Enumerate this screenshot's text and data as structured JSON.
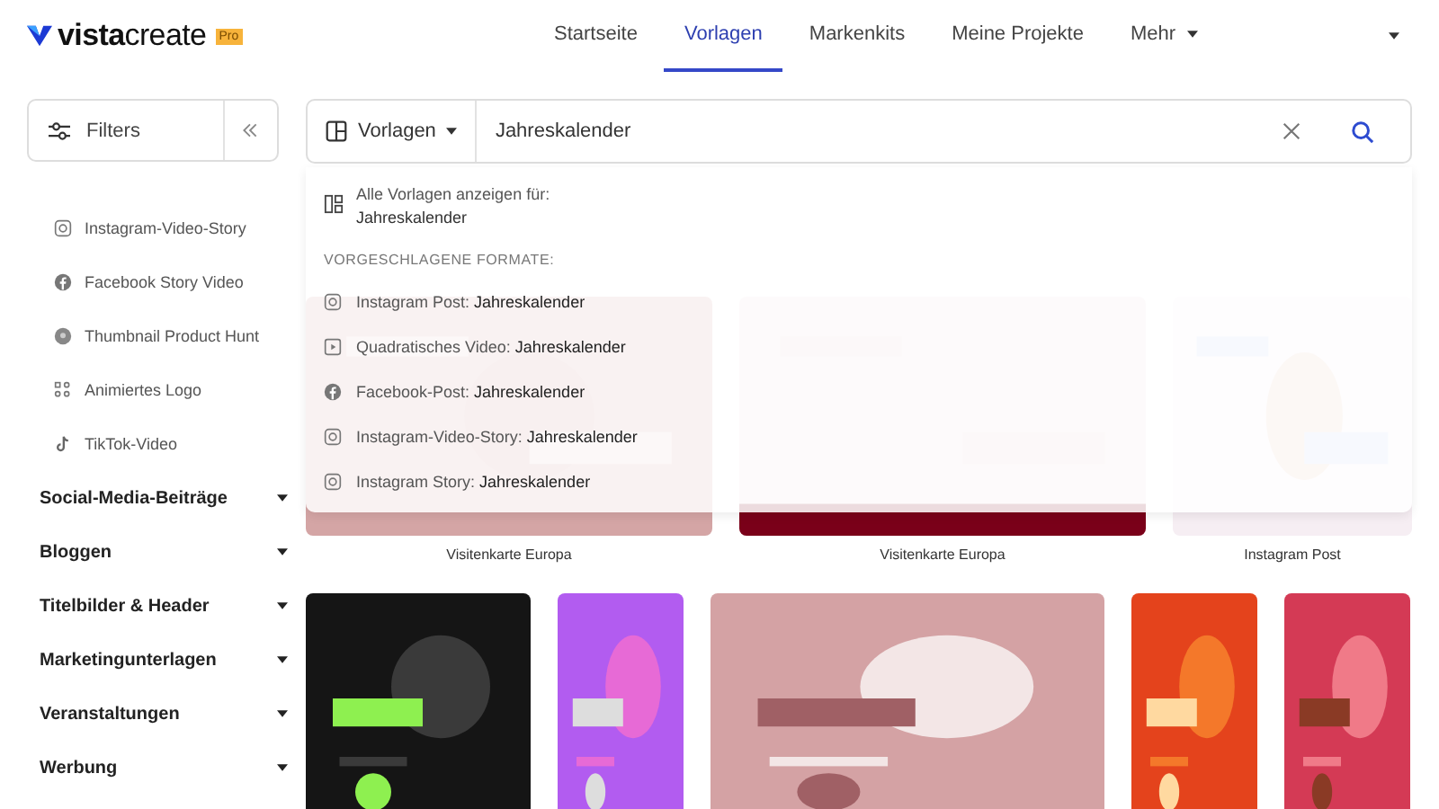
{
  "header": {
    "logo": "**vista**create",
    "badge": "Pro",
    "nav": [
      {
        "label": "Startseite",
        "selected": false
      },
      {
        "label": "Vorlagen",
        "selected": true
      },
      {
        "label": "Markenkits",
        "selected": false
      },
      {
        "label": "Meine Projekte",
        "selected": false
      },
      {
        "label": "Mehr",
        "selected": false,
        "kind": "menu"
      }
    ]
  },
  "sidebar": {
    "filters": "Filters",
    "items": [
      {
        "label": "Instagram-Video-Story",
        "kind": "format"
      },
      {
        "label": "Facebook Story Video",
        "kind": "format"
      },
      {
        "label": "Thumbnail Product Hunt",
        "kind": "format"
      },
      {
        "label": "Animiertes Logo",
        "kind": "format"
      },
      {
        "label": "TikTok-Video",
        "kind": "format"
      },
      {
        "label": "Social-Media-Beiträge",
        "kind": "category"
      },
      {
        "label": "Bloggen",
        "kind": "category"
      },
      {
        "label": "Titelbilder & Header",
        "kind": "category"
      },
      {
        "label": "Marketingunterlagen",
        "kind": "category"
      },
      {
        "label": "Veranstaltungen",
        "kind": "category"
      },
      {
        "label": "Werbung",
        "kind": "category"
      }
    ]
  },
  "search": {
    "scope": "Vorlagen",
    "value": "Jahreskalender"
  },
  "dropdown": {
    "all_label": "Alle Vorlagen anzeigen für:",
    "all_query": "Jahreskalender",
    "section": "VORGESCHLAGENE FORMATE:",
    "suggestions": [
      "Instagram Post: **Jahreskalender**",
      "Quadratisches Video: **Jahreskalender**",
      "Facebook-Post: **Jahreskalender**",
      "Instagram-Video-Story: **Jahreskalender**",
      "Instagram Story: **Jahreskalender**"
    ]
  },
  "templates": [
    {
      "kind": "picture",
      "label": "Visitenkarte Europa"
    },
    {
      "kind": "picture",
      "label": "Visitenkarte Europa"
    },
    {
      "kind": "picture",
      "label": "Instagram Post"
    },
    {
      "kind": "picture"
    },
    {
      "kind": "picture"
    },
    {
      "kind": "picture"
    },
    {
      "kind": "picture"
    },
    {
      "kind": "picture"
    }
  ]
}
